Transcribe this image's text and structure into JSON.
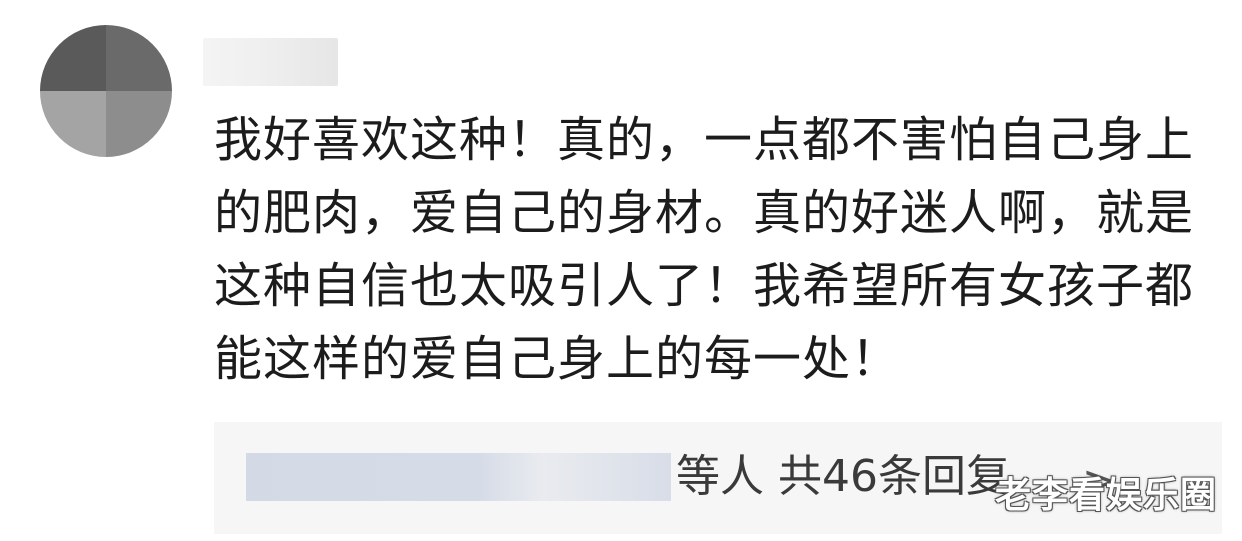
{
  "comment": {
    "text": "我好喜欢这种！真的，一点都不害怕自己身上的肥肉，爱自己的身材。真的好迷人啊，就是这种自信也太吸引人了！我希望所有女孩子都能这样的爱自己身上的每一处！"
  },
  "replies": {
    "suffix": "等人",
    "count_text": "共46条回复",
    "chevron_icon": "chevron-right-icon"
  },
  "watermark": {
    "text": "老李看娱乐圈"
  },
  "colors": {
    "reply_background": "#f6f6f6",
    "text": "#1c1c1c",
    "blur_blue": "#d3dae6"
  }
}
